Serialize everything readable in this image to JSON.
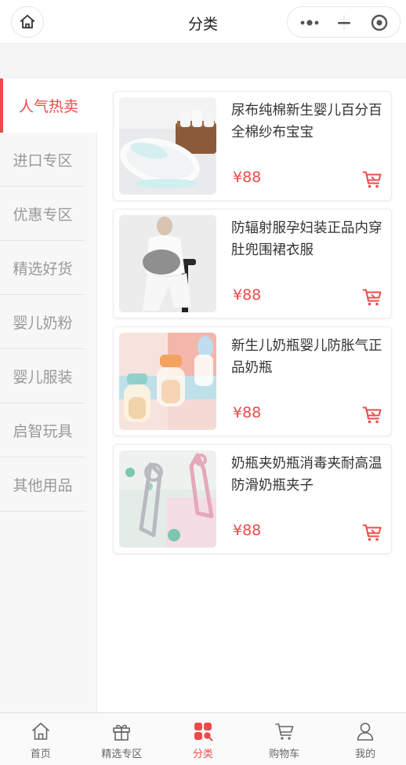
{
  "header": {
    "title": "分类"
  },
  "sidebar": {
    "items": [
      {
        "label": "人气热卖",
        "active": true
      },
      {
        "label": "进口专区",
        "active": false
      },
      {
        "label": "优惠专区",
        "active": false
      },
      {
        "label": "精选好货",
        "active": false
      },
      {
        "label": "婴儿奶粉",
        "active": false
      },
      {
        "label": "婴儿服装",
        "active": false
      },
      {
        "label": "启智玩具",
        "active": false
      },
      {
        "label": "其他用品",
        "active": false
      }
    ]
  },
  "products": [
    {
      "name": "尿布纯棉新生婴儿百分百全棉纱布宝宝",
      "price": "¥88",
      "image": "diaper-cloth"
    },
    {
      "name": "防辐射服孕妇装正品内穿肚兜围裙衣服",
      "price": "¥88",
      "image": "maternity-apron"
    },
    {
      "name": "新生儿奶瓶婴儿防胀气正品奶瓶",
      "price": "¥88",
      "image": "baby-bottles"
    },
    {
      "name": "奶瓶夹奶瓶消毒夹耐高温防滑奶瓶夹子",
      "price": "¥88",
      "image": "bottle-tongs"
    }
  ],
  "tabbar": {
    "items": [
      {
        "label": "首页",
        "icon": "home-icon",
        "active": false
      },
      {
        "label": "精选专区",
        "icon": "gift-icon",
        "active": false
      },
      {
        "label": "分类",
        "icon": "category-icon",
        "active": true
      },
      {
        "label": "购物车",
        "icon": "cart-icon",
        "active": false
      },
      {
        "label": "我的",
        "icon": "user-icon",
        "active": false
      }
    ]
  },
  "colors": {
    "accent": "#ef4a4a",
    "inactive_text": "#999999",
    "sidebar_bg": "#f7f7f7"
  }
}
